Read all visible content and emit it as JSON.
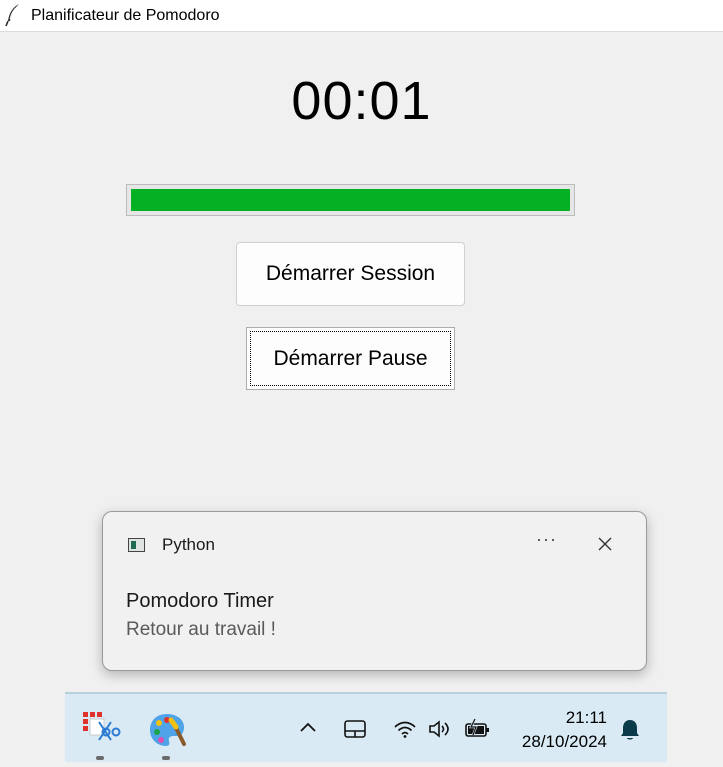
{
  "window": {
    "title": "Planificateur de Pomodoro",
    "icon": "feather-icon"
  },
  "timer": {
    "display": "00:01"
  },
  "progress": {
    "fraction": 1.0,
    "color": "#06b025"
  },
  "buttons": {
    "start_session": "Démarrer Session",
    "start_pause": "Démarrer Pause"
  },
  "notification": {
    "app_name": "Python",
    "title": "Pomodoro Timer",
    "message": "Retour au travail !",
    "more_label": "···",
    "icons": {
      "app": "python-window-icon",
      "close": "close-icon"
    }
  },
  "taskbar": {
    "pinned": [
      "snipping-tool-icon",
      "paint-icon"
    ],
    "tray": [
      "chevron-up-icon",
      "touchpad-icon",
      "wifi-icon",
      "volume-icon",
      "battery-icon",
      "bell-icon"
    ],
    "time": "21:11",
    "date": "28/10/2024"
  }
}
